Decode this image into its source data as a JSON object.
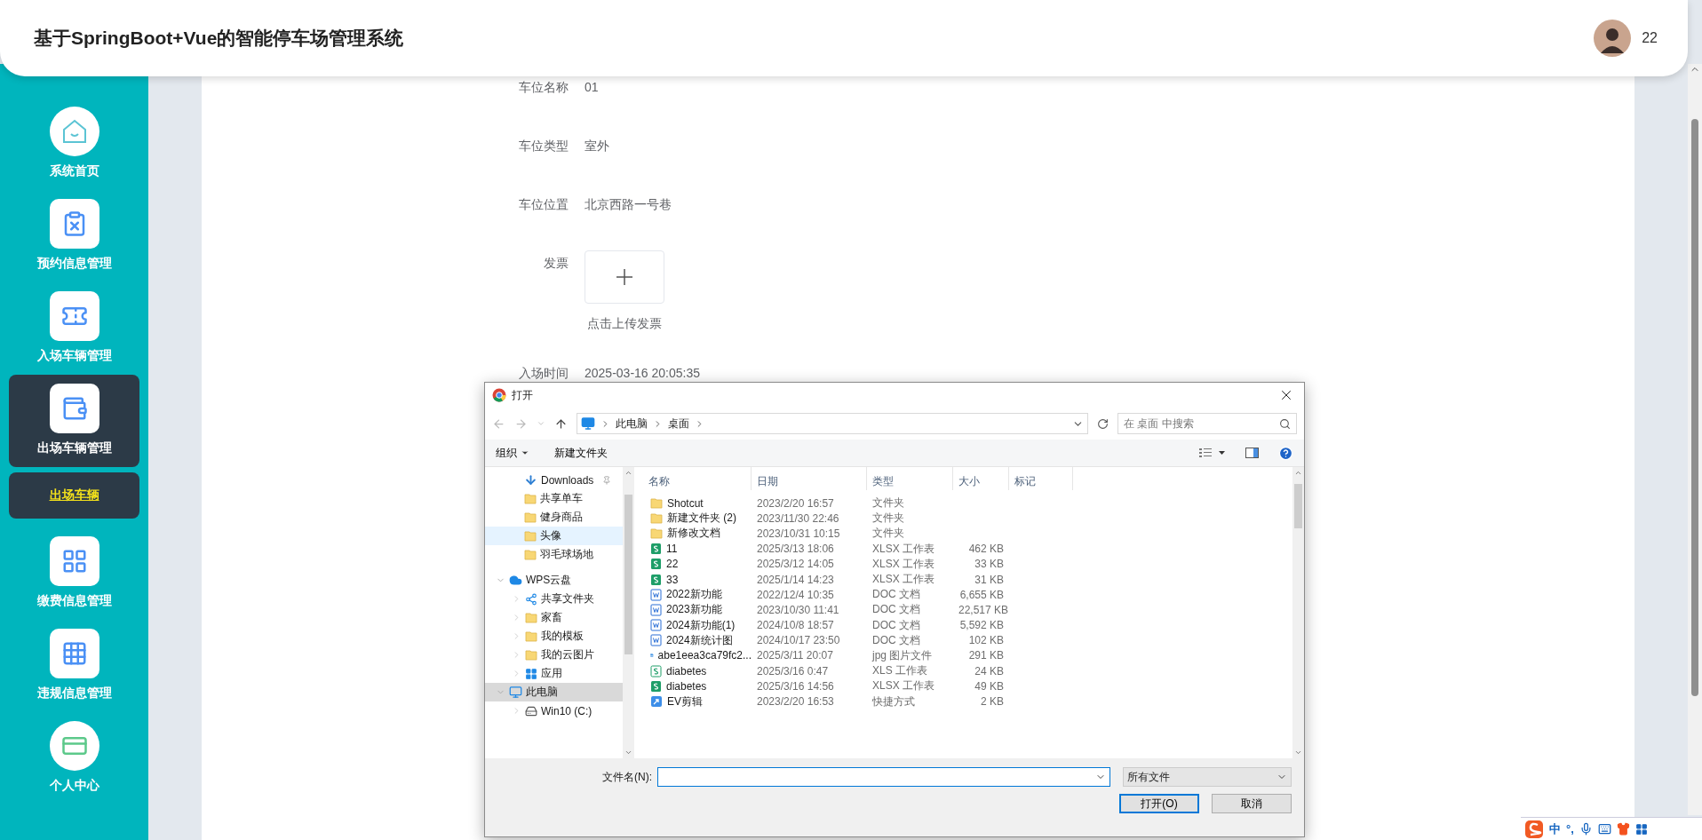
{
  "header": {
    "title": "基于SpringBoot+Vue的智能停车场管理系统",
    "username": "22"
  },
  "sidebar": {
    "items": [
      {
        "label": "系统首页",
        "kind": "home",
        "selected": false
      },
      {
        "label": "预约信息管理",
        "kind": "clipboard",
        "selected": false
      },
      {
        "label": "入场车辆管理",
        "kind": "ticket",
        "selected": false
      },
      {
        "label": "出场车辆管理",
        "kind": "wallet",
        "selected": true,
        "children": [
          {
            "label": "出场车辆",
            "selected": true
          }
        ]
      },
      {
        "label": "缴费信息管理",
        "kind": "tiles",
        "selected": false
      },
      {
        "label": "违规信息管理",
        "kind": "grid",
        "selected": false
      },
      {
        "label": "个人中心",
        "kind": "card",
        "selected": false
      }
    ]
  },
  "form": {
    "fields": [
      {
        "kind": "text",
        "label": "车位名称",
        "value": "01"
      },
      {
        "kind": "text",
        "label": "车位类型",
        "value": "室外"
      },
      {
        "kind": "text",
        "label": "车位位置",
        "value": "北京西路一号巷"
      },
      {
        "kind": "upload",
        "label": "发票",
        "caption": "点击上传发票"
      },
      {
        "kind": "text",
        "label": "入场时间",
        "value": "2025-03-16 20:05:35"
      }
    ]
  },
  "dialog": {
    "title": "打开",
    "path": [
      "此电脑",
      "桌面"
    ],
    "search": {
      "placeholder": "在 桌面 中搜索"
    },
    "toolbar": [
      "组织",
      "新建文件夹"
    ],
    "nav": {
      "quick_access": [
        {
          "label": "Downloads",
          "kind": "download",
          "pinned": true,
          "selected": false,
          "hovered": false
        },
        {
          "label": "共享单车",
          "kind": "folder",
          "pinned": false,
          "selected": false,
          "hovered": false
        },
        {
          "label": "健身商品",
          "kind": "folder",
          "pinned": false,
          "selected": false,
          "hovered": false
        },
        {
          "label": "头像",
          "kind": "folder",
          "pinned": false,
          "selected": false,
          "hovered": true
        },
        {
          "label": "羽毛球场地",
          "kind": "folder",
          "pinned": false,
          "selected": false,
          "hovered": false
        }
      ],
      "roots": [
        {
          "label": "WPS云盘",
          "kind": "cloud",
          "expanded": true,
          "selected": false,
          "children": [
            {
              "label": "共享文件夹",
              "kind": "share",
              "expanded": false,
              "selected": false
            },
            {
              "label": "家畜",
              "kind": "folder",
              "expanded": false,
              "selected": false
            },
            {
              "label": "我的模板",
              "kind": "folder",
              "expanded": false,
              "selected": false
            },
            {
              "label": "我的云图片",
              "kind": "folder",
              "expanded": false,
              "selected": false
            },
            {
              "label": "应用",
              "kind": "apps",
              "expanded": false,
              "selected": false
            }
          ]
        },
        {
          "label": "此电脑",
          "kind": "pc",
          "expanded": true,
          "selected": true,
          "children": [
            {
              "label": "Win10 (C:)",
              "kind": "drive",
              "expanded": false,
              "selected": false
            }
          ]
        }
      ]
    },
    "columns": [
      "名称",
      "日期",
      "类型",
      "大小",
      "标记"
    ],
    "files": [
      {
        "kind": "folder",
        "name": "Shotcut",
        "date": "2023/2/20 16:57",
        "type": "文件夹"
      },
      {
        "kind": "folder",
        "name": "新建文件夹 (2)",
        "date": "2023/11/30 22:46",
        "type": "文件夹"
      },
      {
        "kind": "folder",
        "name": "新修改文档",
        "date": "2023/10/31 10:15",
        "type": "文件夹"
      },
      {
        "kind": "xlsx",
        "name": "11",
        "date": "2025/3/13 18:06",
        "type": "XLSX 工作表",
        "size": "462 KB"
      },
      {
        "kind": "xlsx",
        "name": "22",
        "date": "2025/3/12 14:05",
        "type": "XLSX 工作表",
        "size": "33 KB"
      },
      {
        "kind": "xlsx",
        "name": "33",
        "date": "2025/1/14 14:23",
        "type": "XLSX 工作表",
        "size": "31 KB"
      },
      {
        "kind": "doc",
        "name": "2022新功能",
        "date": "2022/12/4 10:35",
        "type": "DOC 文档",
        "size": "6,655 KB"
      },
      {
        "kind": "doc",
        "name": "2023新功能",
        "date": "2023/10/30 11:41",
        "type": "DOC 文档",
        "size": "22,517 KB"
      },
      {
        "kind": "doc",
        "name": "2024新功能(1)",
        "date": "2024/10/8 18:57",
        "type": "DOC 文档",
        "size": "5,592 KB"
      },
      {
        "kind": "doc",
        "name": "2024新统计图",
        "date": "2024/10/17 23:50",
        "type": "DOC 文档",
        "size": "102 KB"
      },
      {
        "kind": "jpg",
        "name": "abe1eea3ca79fc2...",
        "date": "2025/3/11 20:07",
        "type": "jpg 图片文件",
        "size": "291 KB"
      },
      {
        "kind": "xls",
        "name": "diabetes",
        "date": "2025/3/16 0:47",
        "type": "XLS 工作表",
        "size": "24 KB"
      },
      {
        "kind": "xlsx",
        "name": "diabetes",
        "date": "2025/3/16 14:56",
        "type": "XLSX 工作表",
        "size": "49 KB"
      },
      {
        "kind": "shortcut",
        "name": "EV剪辑",
        "date": "2023/2/20 16:53",
        "type": "快捷方式",
        "size": "2 KB"
      }
    ],
    "filename": {
      "label": "文件名(N):"
    },
    "filter": "所有文件",
    "buttons": [
      {
        "label": "打开(O)",
        "kind": "primary"
      },
      {
        "label": "取消",
        "kind": "normal"
      }
    ]
  },
  "ime": {
    "mode": "中",
    "punct": "°,"
  }
}
